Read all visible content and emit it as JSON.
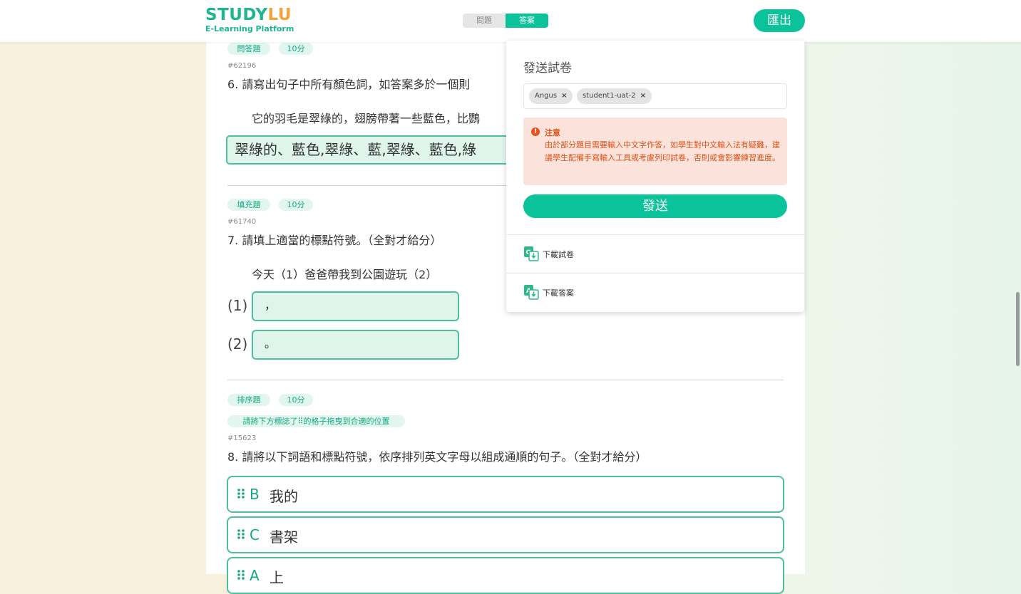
{
  "header": {
    "logo_main": "STUDY",
    "logo_accent": "LU",
    "logo_sub": "E-Learning Platform",
    "toggle_question": "問題",
    "toggle_answer": "答案",
    "exit_label": "匯出"
  },
  "questions": {
    "q6": {
      "type_tag": "問答題",
      "score_tag": "10分",
      "id": "#62196",
      "text": "6.   請寫出句子中所有顏色詞，如答案多於一個則",
      "sub": "它的羽毛是翠綠的，翅膀帶著一些藍色，比鸚",
      "answer": "翠綠的、藍色,翠綠、藍,翠綠、藍色,綠"
    },
    "q7": {
      "type_tag": "填充題",
      "score_tag": "10分",
      "id": "#61740",
      "text": "7.   請填上適當的標點符號。（全對才給分）",
      "sub": "今天（1）爸爸帶我到公園遊玩（2）",
      "blank1_label": "(1)",
      "blank1_value": "，",
      "blank2_label": "(2)",
      "blank2_value": "。"
    },
    "q8": {
      "type_tag": "排序題",
      "score_tag": "10分",
      "hint_tag": "請將下方標誌了⠿的格子拖曳到合適的位置",
      "id": "#15623",
      "text": "8.   請將以下詞語和標點符號，依序排列英文字母以組成通順的句子。（全對才給分）",
      "items": [
        {
          "letter": "B",
          "word": "我的"
        },
        {
          "letter": "C",
          "word": "書架"
        },
        {
          "letter": "A",
          "word": "上"
        }
      ]
    }
  },
  "popup": {
    "title": "發送試卷",
    "recipients": [
      "Angus",
      "student1-uat-2"
    ],
    "remove_symbol": "×",
    "warning_icon": "!",
    "warning_title": "注意",
    "warning_body": "由於部分題目需要輸入中文字作答，如學生對中文輸入法有疑難，建議學生配備手寫輸入工具或考慮列印試卷，否則或會影響練習進度。",
    "send_label": "發送",
    "download_paper": "下載試卷",
    "download_answer": "下載答案"
  },
  "colors": {
    "accent": "#0bc39b",
    "logo_accent": "#f2a23a",
    "warning_bg": "#fbe2da",
    "warning_text": "#d9541b"
  },
  "icons": {
    "download_paper": "download-question-paper-icon",
    "download_answer": "download-answer-icon",
    "drag": "drag-handle-icon",
    "warning": "warning-icon"
  }
}
